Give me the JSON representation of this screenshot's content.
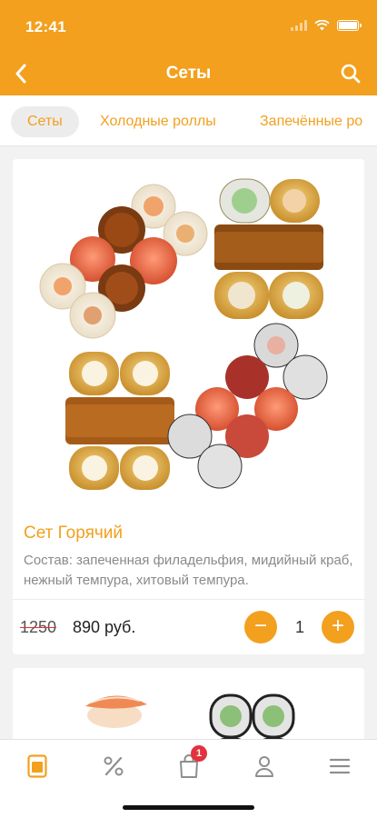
{
  "status_bar": {
    "time": "12:41"
  },
  "header": {
    "title": "Сеты",
    "back_icon": "chevron-left-icon",
    "search_icon": "search-icon"
  },
  "tabs": [
    {
      "label": "Сеты",
      "active": true
    },
    {
      "label": "Холодные роллы",
      "active": false
    },
    {
      "label": "Запечённые ро",
      "active": false
    }
  ],
  "products": [
    {
      "title": "Сет Горячий",
      "description": "Состав: запеченная филадельфия, мидийный краб, нежный темпура, хитовый темпура.",
      "old_price": "1250",
      "price": "890 руб.",
      "quantity": "1"
    }
  ],
  "bottom_nav": {
    "items": [
      {
        "icon": "menu-card-icon",
        "active": true
      },
      {
        "icon": "percent-icon",
        "active": false
      },
      {
        "icon": "cart-bag-icon",
        "active": false,
        "badge": "1"
      },
      {
        "icon": "profile-icon",
        "active": false
      },
      {
        "icon": "hamburger-menu-icon",
        "active": false
      }
    ]
  },
  "colors": {
    "accent": "#f2a01e",
    "badge": "#e5313e",
    "strike": "#e0322c"
  }
}
